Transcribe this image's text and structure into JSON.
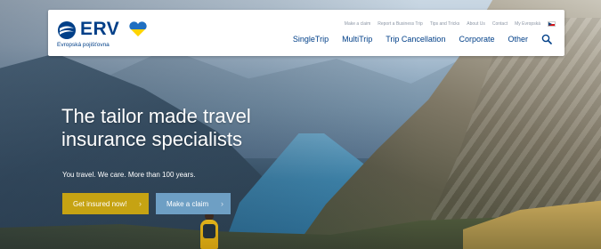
{
  "brand": {
    "name": "ERV",
    "tagline": "Evropská pojišťovna",
    "colors": {
      "primary": "#003f88",
      "heart_top": "#1f6fc1",
      "heart_bottom": "#ffd400"
    }
  },
  "utility_nav": {
    "items": [
      "Make a claim",
      "Report a Business Trip",
      "Tips and Tricks",
      "About Us",
      "Contact",
      "My Evropská"
    ],
    "language_flag": "czech-flag-icon"
  },
  "main_nav": {
    "items": [
      "SingleTrip",
      "MultiTrip",
      "Trip Cancellation",
      "Corporate",
      "Other"
    ],
    "search_icon": "search-icon"
  },
  "hero": {
    "title_line1": "The tailor made travel",
    "title_line2": "insurance specialists",
    "subtitle": "You travel. We care. More than 100 years.",
    "cta_primary": "Get insured now!",
    "cta_secondary": "Make a claim",
    "colors": {
      "cta_primary": "#c6a313",
      "cta_secondary": "#6e9fc4"
    }
  }
}
